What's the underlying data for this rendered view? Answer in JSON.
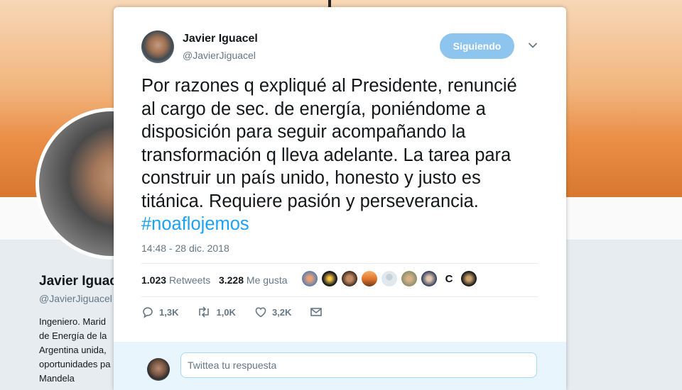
{
  "background_profile": {
    "name": "Javier Iguac",
    "handle": "@JavierJiguacel",
    "bio": "Ingeniero. Marid\nde Energía de la\nArgentina unida,\noportunidades pa\nMandela"
  },
  "tweet": {
    "author_name": "Javier Iguacel",
    "author_handle": "@JavierJiguacel",
    "follow_label": "Siguiendo",
    "text": "Por razones q expliqué al Presidente, renuncié\nal cargo de sec. de energía, poniéndome a\ndisposición para seguir acompañando la\ntransformación q lleva adelante. La tarea para\nconstruir un país unido, honesto y justo es\ntitánica. Requiere pasión y perseverancia.",
    "hashtag": "#noaflojemos",
    "timestamp": "14:48 - 28 dic. 2018",
    "retweets_count": "1.023",
    "retweets_label": "Retweets",
    "likes_count": "3.228",
    "likes_label": "Me gusta",
    "actions": {
      "reply_count": "1,3K",
      "retweet_count": "1,0K",
      "like_count": "3,2K"
    },
    "reply_placeholder": "Twittea tu respuesta"
  },
  "colors": {
    "follow_button": "#8ec5ee",
    "hashtag": "#1da1f2",
    "secondary_text": "#657786",
    "reply_bar": "#e8f5fd"
  }
}
